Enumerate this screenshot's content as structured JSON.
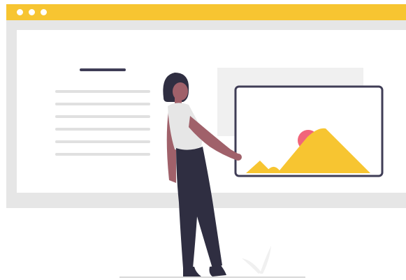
{
  "illustration": {
    "scene": "woman-presenting-image-on-web-page",
    "colors": {
      "accent": "#f7c531",
      "frame": "#e6e6e6",
      "surface": "#ffffff",
      "placeholder_line": "#e0e0e0",
      "ink": "#3f3d56",
      "sun": "#f1657a",
      "skin": "#a0616a",
      "hair": "#2f2e41",
      "shirt": "#e6e6e6",
      "pants": "#2f2e41"
    },
    "window_dots": 3,
    "text_placeholder_lines": 6,
    "icons": [
      "image-frame-icon",
      "mountain-icon",
      "sun-icon",
      "plant-icon"
    ]
  }
}
